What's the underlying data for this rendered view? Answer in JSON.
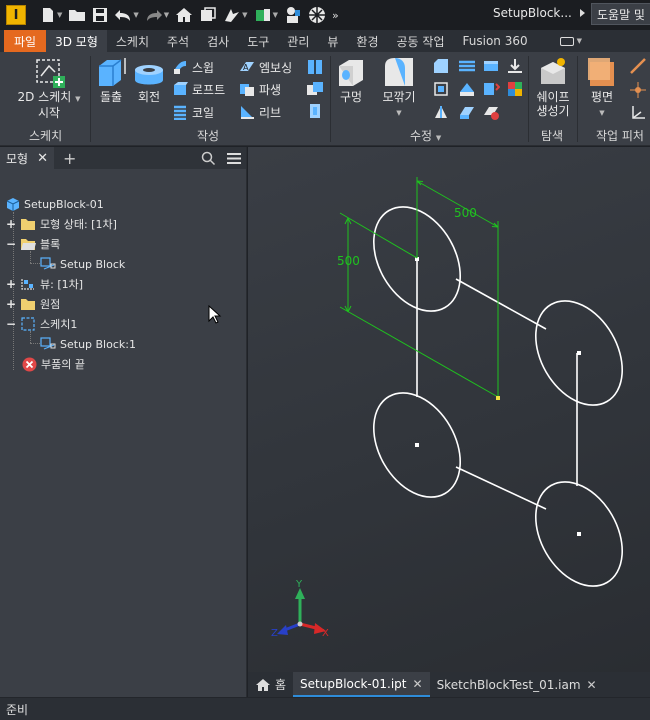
{
  "app": {
    "logo_letter": "I",
    "document_title": "SetupBlock...",
    "help_search": "도움말 및"
  },
  "ribbon_tabs": [
    {
      "label": "파일"
    },
    {
      "label": "3D 모형"
    },
    {
      "label": "스케치"
    },
    {
      "label": "주석"
    },
    {
      "label": "검사"
    },
    {
      "label": "도구"
    },
    {
      "label": "관리"
    },
    {
      "label": "뷰"
    },
    {
      "label": "환경"
    },
    {
      "label": "공동 작업"
    },
    {
      "label": "Fusion 360"
    }
  ],
  "ribbon": {
    "sketch_group": {
      "button_line1": "2D 스케치",
      "button_line2": "시작",
      "label": "스케치"
    },
    "create_group": {
      "extrude": "돌출",
      "revolve": "회전",
      "sweep": "스윕",
      "loft": "로프트",
      "coil": "코일",
      "emboss": "엠보싱",
      "derive": "파생",
      "rib": "리브",
      "label": "작성"
    },
    "modify_group": {
      "hole": "구멍",
      "fillet": "모깎기",
      "label": "수정"
    },
    "explore_group": {
      "shape_line1": "쉐이프",
      "shape_line2": "생성기",
      "label": "탐색"
    },
    "work_group": {
      "plane": "평면",
      "label": "작업 피처"
    }
  },
  "browser": {
    "tab_label": "모형",
    "tree": [
      {
        "label": "SetupBlock-01"
      },
      {
        "label": "모형 상태: [1차]"
      },
      {
        "label": "블록"
      },
      {
        "label": "Setup Block"
      },
      {
        "label": "뷰: [1차]"
      },
      {
        "label": "원점"
      },
      {
        "label": "스케치1"
      },
      {
        "label": "Setup Block:1"
      },
      {
        "label": "부품의 끝"
      }
    ]
  },
  "viewport": {
    "dimension_horizontal": "500",
    "dimension_vertical": "500",
    "axis_x": "X",
    "axis_y": "Y",
    "axis_z": "Z"
  },
  "doc_tabs": [
    {
      "label": "홈"
    },
    {
      "label": "SetupBlock-01.ipt"
    },
    {
      "label": "SketchBlockTest_01.iam"
    }
  ],
  "status": {
    "text": "준비"
  },
  "colors": {
    "file_tab": "#e5691f",
    "ribbon_bg": "#3b3f46",
    "dimension_green": "#1fc11f",
    "active_doc_underline": "#2e8cd9"
  }
}
